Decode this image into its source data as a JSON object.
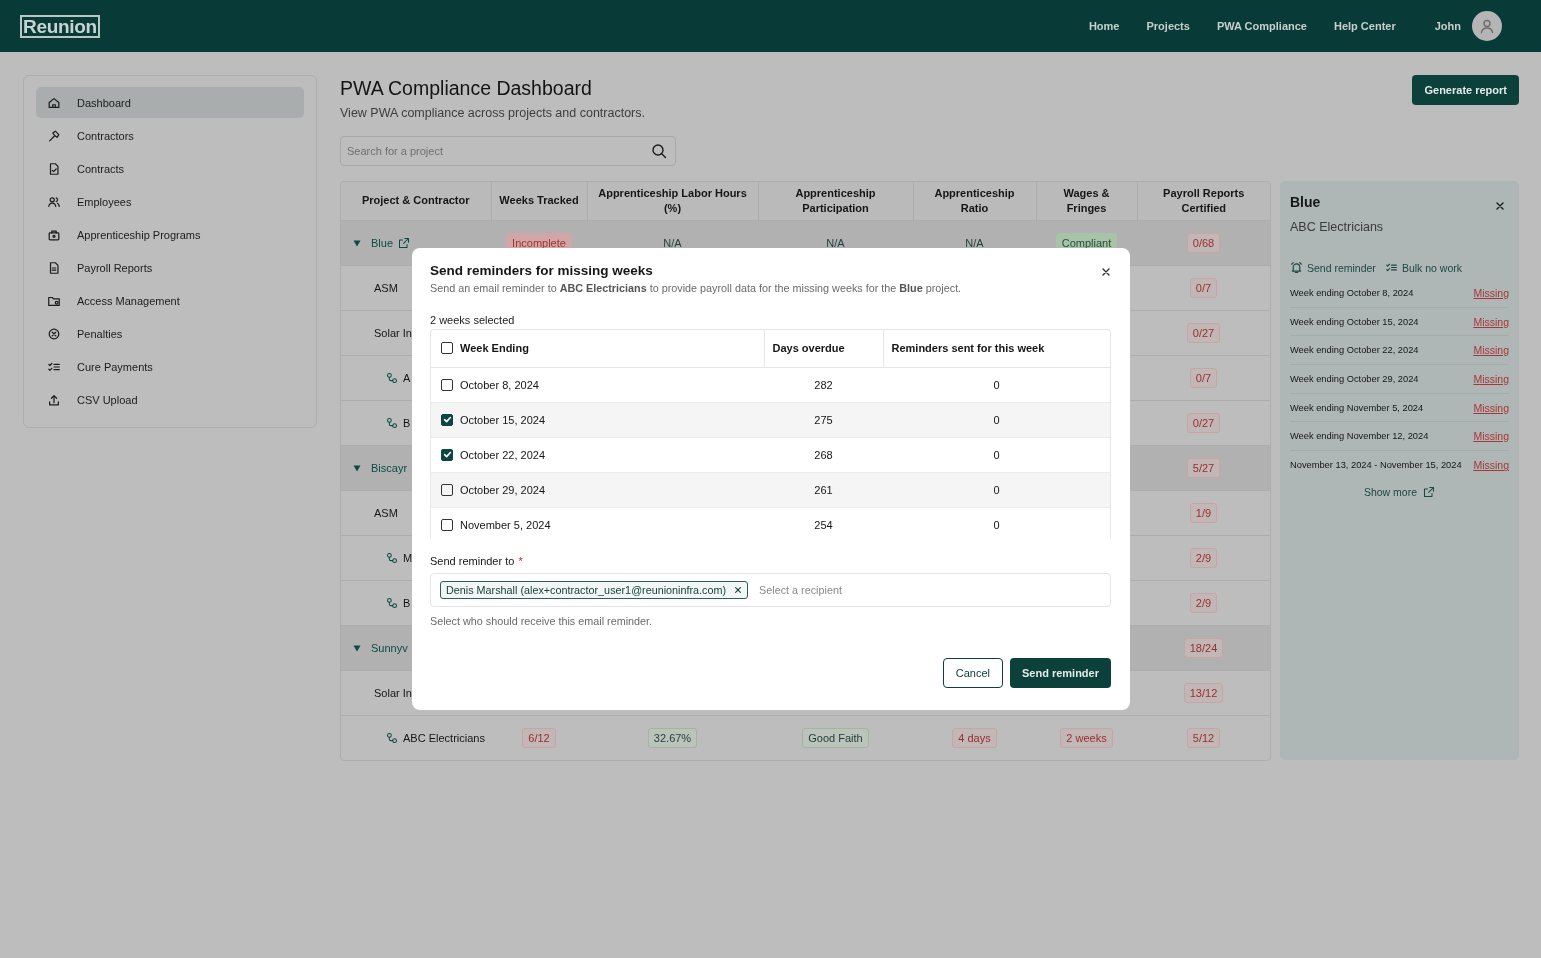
{
  "header": {
    "logo": "Reunion",
    "nav": [
      {
        "label": "Home"
      },
      {
        "label": "Projects"
      },
      {
        "label": "PWA Compliance"
      },
      {
        "label": "Help Center"
      }
    ],
    "user": "John"
  },
  "sidebar": {
    "items": [
      {
        "label": "Dashboard",
        "selected": true
      },
      {
        "label": "Contractors",
        "selected": false
      },
      {
        "label": "Contracts",
        "selected": false
      },
      {
        "label": "Employees",
        "selected": false
      },
      {
        "label": "Apprenticeship Programs",
        "selected": false
      },
      {
        "label": "Payroll Reports",
        "selected": false
      },
      {
        "label": "Access Management",
        "selected": false
      },
      {
        "label": "Penalties",
        "selected": false
      },
      {
        "label": "Cure Payments",
        "selected": false
      },
      {
        "label": "CSV Upload",
        "selected": false
      }
    ]
  },
  "page": {
    "title": "PWA Compliance Dashboard",
    "subtitle": "View PWA compliance across projects and contractors.",
    "action": "Generate report",
    "search": {
      "placeholder": "Search for a project"
    }
  },
  "table": {
    "name_column": "Project & Contractor",
    "columns": [
      "Weeks Tracked",
      "Apprenticeship Labor Hours (%)",
      "Apprenticeship Participation",
      "Apprenticeship Ratio",
      "Wages & Fringes",
      "Payroll Reports Certified"
    ],
    "rows": [
      {
        "name": "Blue",
        "expanded": true,
        "external_link": true,
        "cells": [
          {
            "text": "Incomplete",
            "kind": "dangerfill"
          },
          {
            "text": "N/A",
            "kind": "plain"
          },
          {
            "text": "N/A",
            "kind": "plain"
          },
          {
            "text": "N/A",
            "kind": "plain"
          },
          {
            "text": "Compliant",
            "kind": "successfill"
          },
          {
            "text": "0/68",
            "kind": "danger"
          }
        ],
        "children": [
          {
            "name": "ASM",
            "cells": [
              null,
              null,
              null,
              null,
              null,
              {
                "text": "0/7",
                "kind": "danger"
              }
            ]
          },
          {
            "name": "Solar In",
            "cells": [
              null,
              null,
              null,
              null,
              null,
              {
                "text": "0/27",
                "kind": "danger"
              }
            ],
            "children": [
              {
                "name": "A",
                "cells": [
                  null,
                  null,
                  null,
                  null,
                  null,
                  {
                    "text": "0/7",
                    "kind": "danger"
                  }
                ]
              },
              {
                "name": "B",
                "cells": [
                  null,
                  null,
                  null,
                  null,
                  null,
                  {
                    "text": "0/27",
                    "kind": "danger"
                  }
                ]
              }
            ]
          }
        ]
      },
      {
        "name": "Biscayr",
        "expanded": true,
        "cells": [
          null,
          null,
          null,
          null,
          null,
          {
            "text": "5/27",
            "kind": "danger"
          }
        ],
        "children": [
          {
            "name": "ASM",
            "cells": [
              null,
              null,
              null,
              null,
              null,
              {
                "text": "1/9",
                "kind": "danger"
              }
            ],
            "children": [
              {
                "name": "M",
                "cells": [
                  null,
                  null,
                  null,
                  null,
                  null,
                  {
                    "text": "2/9",
                    "kind": "danger"
                  }
                ]
              },
              {
                "name": "B",
                "cells": [
                  null,
                  null,
                  null,
                  null,
                  null,
                  {
                    "text": "2/9",
                    "kind": "danger"
                  }
                ]
              }
            ]
          }
        ]
      },
      {
        "name": "Sunnyv",
        "expanded": true,
        "cells": [
          null,
          null,
          null,
          null,
          null,
          {
            "text": "18/24",
            "kind": "danger"
          }
        ],
        "children": [
          {
            "name": "Solar In",
            "cells": [
              null,
              null,
              null,
              null,
              null,
              {
                "text": "13/12",
                "kind": "danger"
              }
            ],
            "children": [
              {
                "name": "ABC Electricians",
                "cells": [
                  {
                    "text": "6/12",
                    "kind": "danger"
                  },
                  {
                    "text": "32.67%",
                    "kind": "success"
                  },
                  {
                    "text": "Good Faith",
                    "kind": "success"
                  },
                  {
                    "text": "4 days",
                    "kind": "danger"
                  },
                  {
                    "text": "2 weeks",
                    "kind": "danger"
                  },
                  {
                    "text": "5/12",
                    "kind": "danger"
                  }
                ]
              }
            ]
          }
        ]
      }
    ]
  },
  "panel": {
    "title": "Blue",
    "subtitle": "ABC Electricians",
    "actions": [
      {
        "label": "Send reminder"
      },
      {
        "label": "Bulk no work"
      }
    ],
    "weeks": [
      {
        "label": "Week ending October 8, 2024",
        "status": "Missing"
      },
      {
        "label": "Week ending October 15, 2024",
        "status": "Missing"
      },
      {
        "label": "Week ending October 22, 2024",
        "status": "Missing"
      },
      {
        "label": "Week ending October 29, 2024",
        "status": "Missing"
      },
      {
        "label": "Week ending November 5, 2024",
        "status": "Missing"
      },
      {
        "label": "Week ending November 12, 2024",
        "status": "Missing"
      },
      {
        "label": "November 13, 2024 - November 15, 2024",
        "status": "Missing"
      }
    ],
    "show_more": "Show more"
  },
  "modal": {
    "title": "Send reminders for missing weeks",
    "intro": "Send an email reminder to **ABC Electricians** to provide payroll data for the missing weeks for the **Blue** project.",
    "selection_count": "2 weeks selected",
    "select_all": {
      "checked": false
    },
    "columns": [
      "Week Ending",
      "Days overdue",
      "Reminders sent for this week"
    ],
    "rows": [
      {
        "week": "October 8, 2024",
        "days": "282",
        "reminders": "0",
        "checked": false
      },
      {
        "week": "October 15, 2024",
        "days": "275",
        "reminders": "0",
        "checked": true
      },
      {
        "week": "October 22, 2024",
        "days": "268",
        "reminders": "0",
        "checked": true
      },
      {
        "week": "October 29, 2024",
        "days": "261",
        "reminders": "0",
        "checked": false
      },
      {
        "week": "November 5, 2024",
        "days": "254",
        "reminders": "0",
        "checked": false
      }
    ],
    "recipient_label": "Send reminder to",
    "required_mark": "*",
    "recipients": [
      "Denis Marshall (alex+contractor_user1@reunioninfra.com)"
    ],
    "recipient_placeholder": "Select a recipient",
    "help": "Select who should receive this email reminder.",
    "buttons": [
      {
        "label": "Cancel",
        "kind": "secondary"
      },
      {
        "label": "Send reminder",
        "kind": "primary"
      }
    ]
  }
}
